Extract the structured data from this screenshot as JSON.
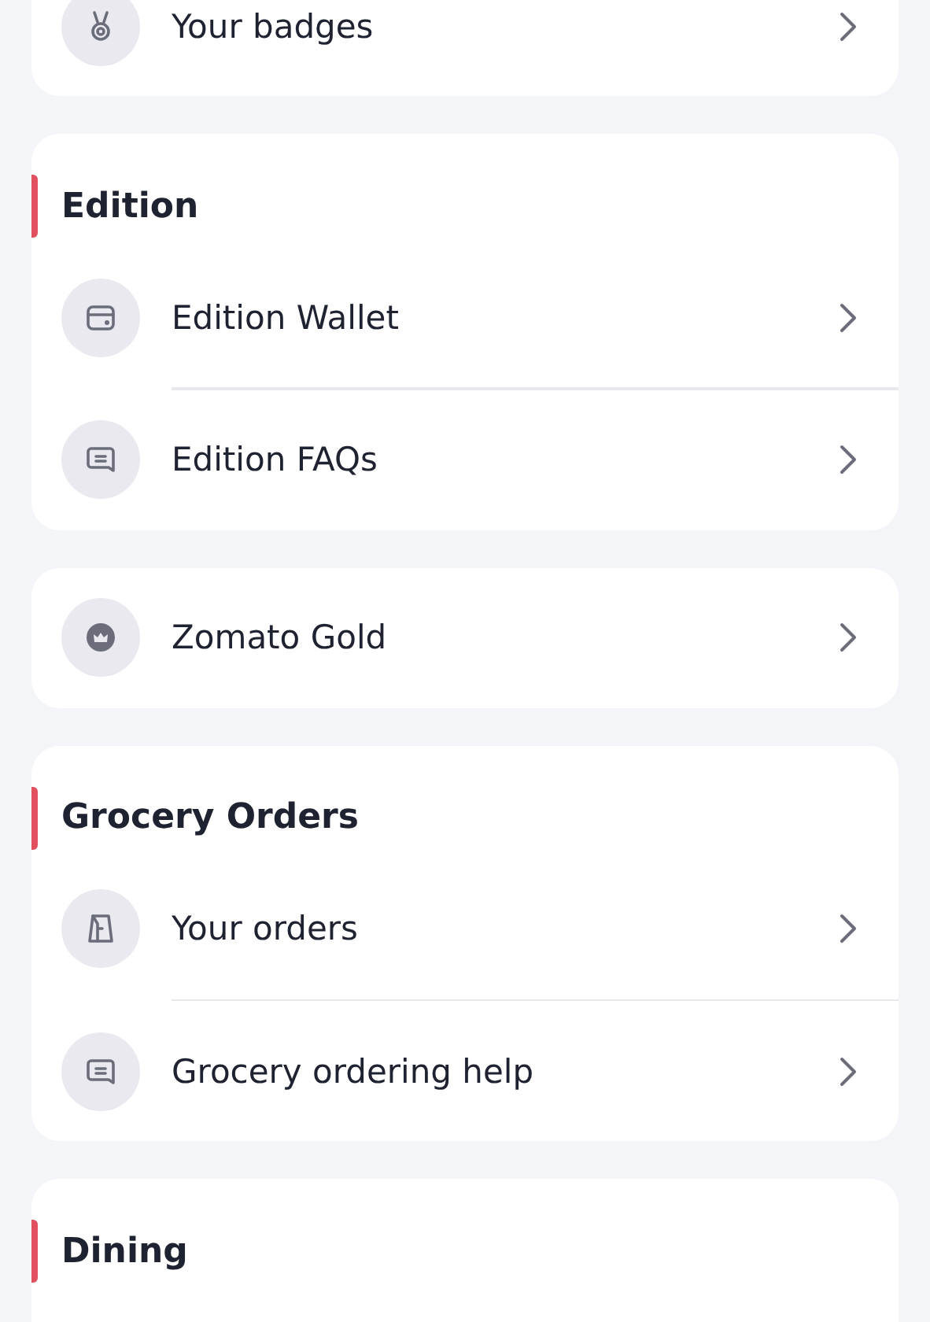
{
  "sections": [
    {
      "items": [
        {
          "label": "Your badges"
        }
      ]
    },
    {
      "title": "Edition",
      "items": [
        {
          "label": "Edition Wallet"
        },
        {
          "label": "Edition FAQs"
        }
      ]
    },
    {
      "items": [
        {
          "label": "Zomato Gold"
        }
      ]
    },
    {
      "title": "Grocery Orders",
      "items": [
        {
          "label": "Your orders"
        },
        {
          "label": "Grocery ordering help"
        }
      ]
    },
    {
      "title": "Dining"
    }
  ]
}
